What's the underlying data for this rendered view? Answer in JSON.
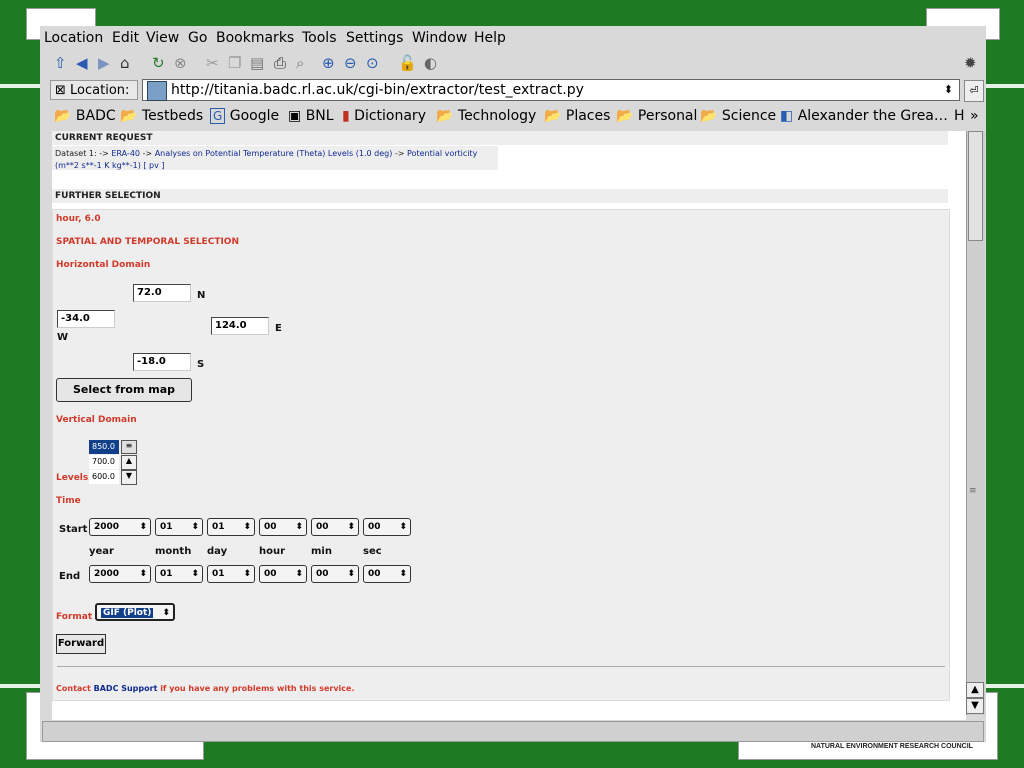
{
  "menu": [
    "Location",
    "Edit",
    "View",
    "Go",
    "Bookmarks",
    "Tools",
    "Settings",
    "Window",
    "Help"
  ],
  "toolbar_icons": [
    "up-icon",
    "back-icon",
    "forward-icon",
    "home-icon",
    "reload-icon",
    "stop-icon",
    "cut-icon",
    "copy-icon",
    "paste-icon",
    "print-icon",
    "find-icon",
    "zoom-in-icon",
    "zoom-out-icon",
    "zoom-reset-icon",
    "security-icon",
    "mic-icon",
    "konqueror-gear-icon"
  ],
  "location": {
    "label": "Location:",
    "url": "http://titania.badc.rl.ac.uk/cgi-bin/extractor/test_extract.py"
  },
  "bookmarks": [
    "BADC",
    "Testbeds",
    "Google",
    "BNL",
    "Dictionary",
    "Technology",
    "Places",
    "Personal",
    "Science",
    "Alexander the Grea…",
    "H",
    "»"
  ],
  "page": {
    "current_request_title": "CURRENT REQUEST",
    "dataset_prefix": "Dataset 1: -> ",
    "dataset_link1": "ERA-40",
    "dataset_arrow": " -> ",
    "dataset_link2": "Analyses on Potential Temperature (Theta) Levels (1.0 deg)",
    "dataset_link3": "Potential vorticity (m**2 s**-1 K kg**-1) [ pv ]",
    "further_title": "FURTHER SELECTION",
    "hour_text": "hour, 6.0",
    "spatial_title": "SPATIAL AND TEMPORAL SELECTION",
    "horiz_title": "Horizontal Domain",
    "north": "72.0",
    "north_label": "N",
    "west": "-34.0",
    "west_label": "W",
    "east": "124.0",
    "east_label": "E",
    "south": "-18.0",
    "south_label": "S",
    "select_map": "Select from map",
    "vertical_title": "Vertical Domain",
    "levels_label": "Levels",
    "levels": [
      "850.0",
      "700.0",
      "600.0"
    ],
    "time_title": "Time",
    "start_label": "Start",
    "end_label": "End",
    "start": [
      "2000",
      "01",
      "01",
      "00",
      "00",
      "00"
    ],
    "end": [
      "2000",
      "01",
      "01",
      "00",
      "00",
      "00"
    ],
    "time_units": [
      "year",
      "month",
      "day",
      "hour",
      "min",
      "sec"
    ],
    "format_label": "Format",
    "format_value": "GIF (Plot)",
    "forward": "Forward",
    "contact_prefix": "Contact ",
    "contact_link": "BADC Support",
    "contact_suffix": " if you have any problems with this service."
  },
  "corner_text": "NATURAL ENVIRONMENT RESEARCH COUNCIL"
}
